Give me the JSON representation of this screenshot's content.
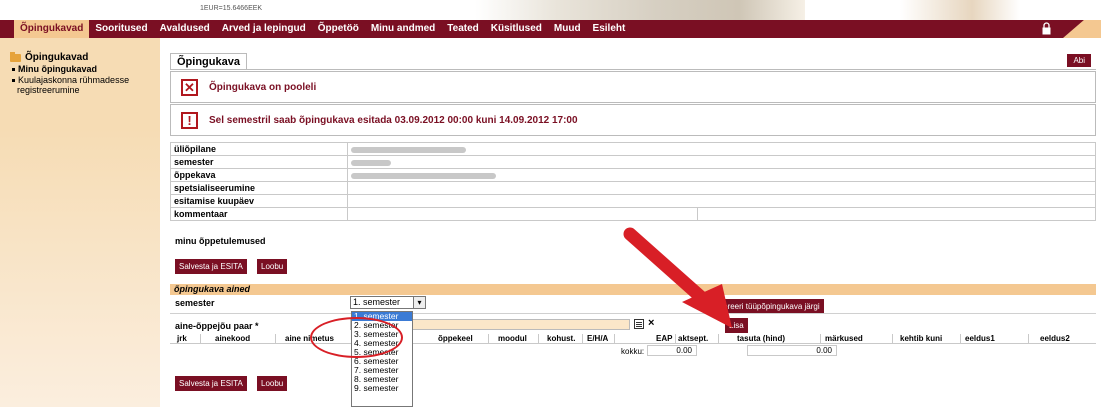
{
  "header": {
    "rate": "1EUR=15.6466EEK"
  },
  "nav": {
    "items": [
      "Õpingukavad",
      "Sooritused",
      "Avaldused",
      "Arved ja lepingud",
      "Õppetöö",
      "Minu andmed",
      "Teated",
      "Küsitlused",
      "Muud",
      "Esileht"
    ]
  },
  "sidebar": {
    "title": "Õpingukavad",
    "items": [
      "Minu õpingukavad",
      "Kuulajaskonna rühmadesse",
      "registreerumine"
    ]
  },
  "main": {
    "tab": "Õpingukava",
    "help_button": "Abi",
    "msg_status": "Õpingukava on pooleli",
    "msg_deadline": "Sel semestril saab õpingukava esitada 03.09.2012 00:00 kuni 14.09.2012 17:00",
    "info_labels": [
      "üliõpilane",
      "semester",
      "õppekava",
      "spetsialiseerumine",
      "esitamise kuupäev",
      "kommentaar"
    ],
    "icons": {
      "status": "x-icon",
      "warning": "exclamation-icon"
    }
  },
  "actions": {
    "minu": "minu õppetulemused",
    "save": "Salvesta ja ESITA",
    "cancel": "Loobu",
    "generate": "Genereeri tüüpõpingukava järgi",
    "add": "Lisa"
  },
  "courses": {
    "section_title": "õpingukava ained",
    "semester_label": "semester",
    "selected": "1. semester",
    "pair_label": "aine-õppejõu paar *",
    "options": [
      "1. semester",
      "2. semester",
      "3. semester",
      "4. semester",
      "5. semester",
      "6. semester",
      "7. semester",
      "8. semester",
      "9. semester"
    ],
    "columns": [
      "jrk",
      "ainekood",
      "aine nimetus",
      "õppekeel",
      "moodul",
      "kohust.",
      "E/H/A",
      "EAP",
      "aktsept.",
      "tasuta (hind)",
      "märkused",
      "kehtib kuni",
      "eeldus1",
      "eeldus2"
    ],
    "total_label": "kokku:",
    "eap_total": "0.00",
    "price_total": "0.00"
  },
  "colors": {
    "brand": "#7a0f23",
    "accent": "#f4c891",
    "annotation": "#d81f26"
  }
}
